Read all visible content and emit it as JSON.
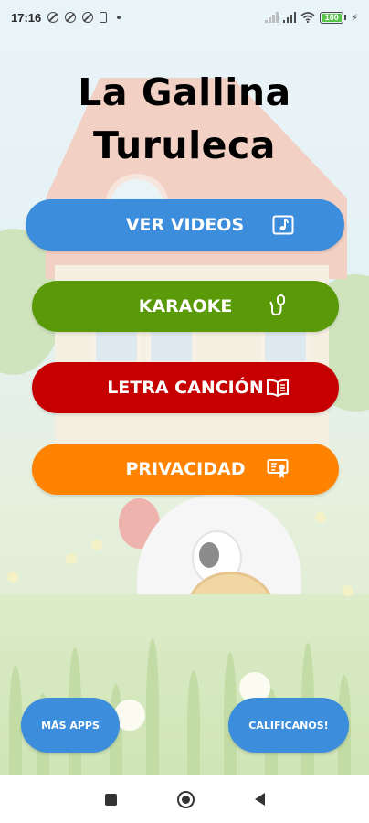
{
  "status_bar": {
    "time": "17:16",
    "battery_level": "100",
    "icons": [
      "alarm-off-icon",
      "block-icon",
      "block-icon",
      "phone-icon",
      "dot-icon",
      "signal-icon",
      "signal-icon",
      "wifi-icon",
      "battery-icon",
      "charging-icon"
    ]
  },
  "title": {
    "line1": "La Gallina",
    "line2": "Turuleca"
  },
  "menu": {
    "videos": {
      "label": "VER VIDEOS",
      "icon": "music-note-icon",
      "color": "#3c8ddb"
    },
    "karaoke": {
      "label": "KARAOKE",
      "icon": "microphone-icon",
      "color": "#5a9a08"
    },
    "letra": {
      "label": "LETRA CANCIÓN",
      "icon": "book-icon",
      "color": "#c60000"
    },
    "privacidad": {
      "label": "PRIVACIDAD",
      "icon": "certificate-icon",
      "color": "#ff8200"
    }
  },
  "footer_buttons": {
    "mas_apps": "MÁS APPS",
    "calificanos": "CALIFICANOS!"
  },
  "nav_bar": {
    "icons": [
      "recents-icon",
      "home-icon",
      "back-icon"
    ]
  }
}
